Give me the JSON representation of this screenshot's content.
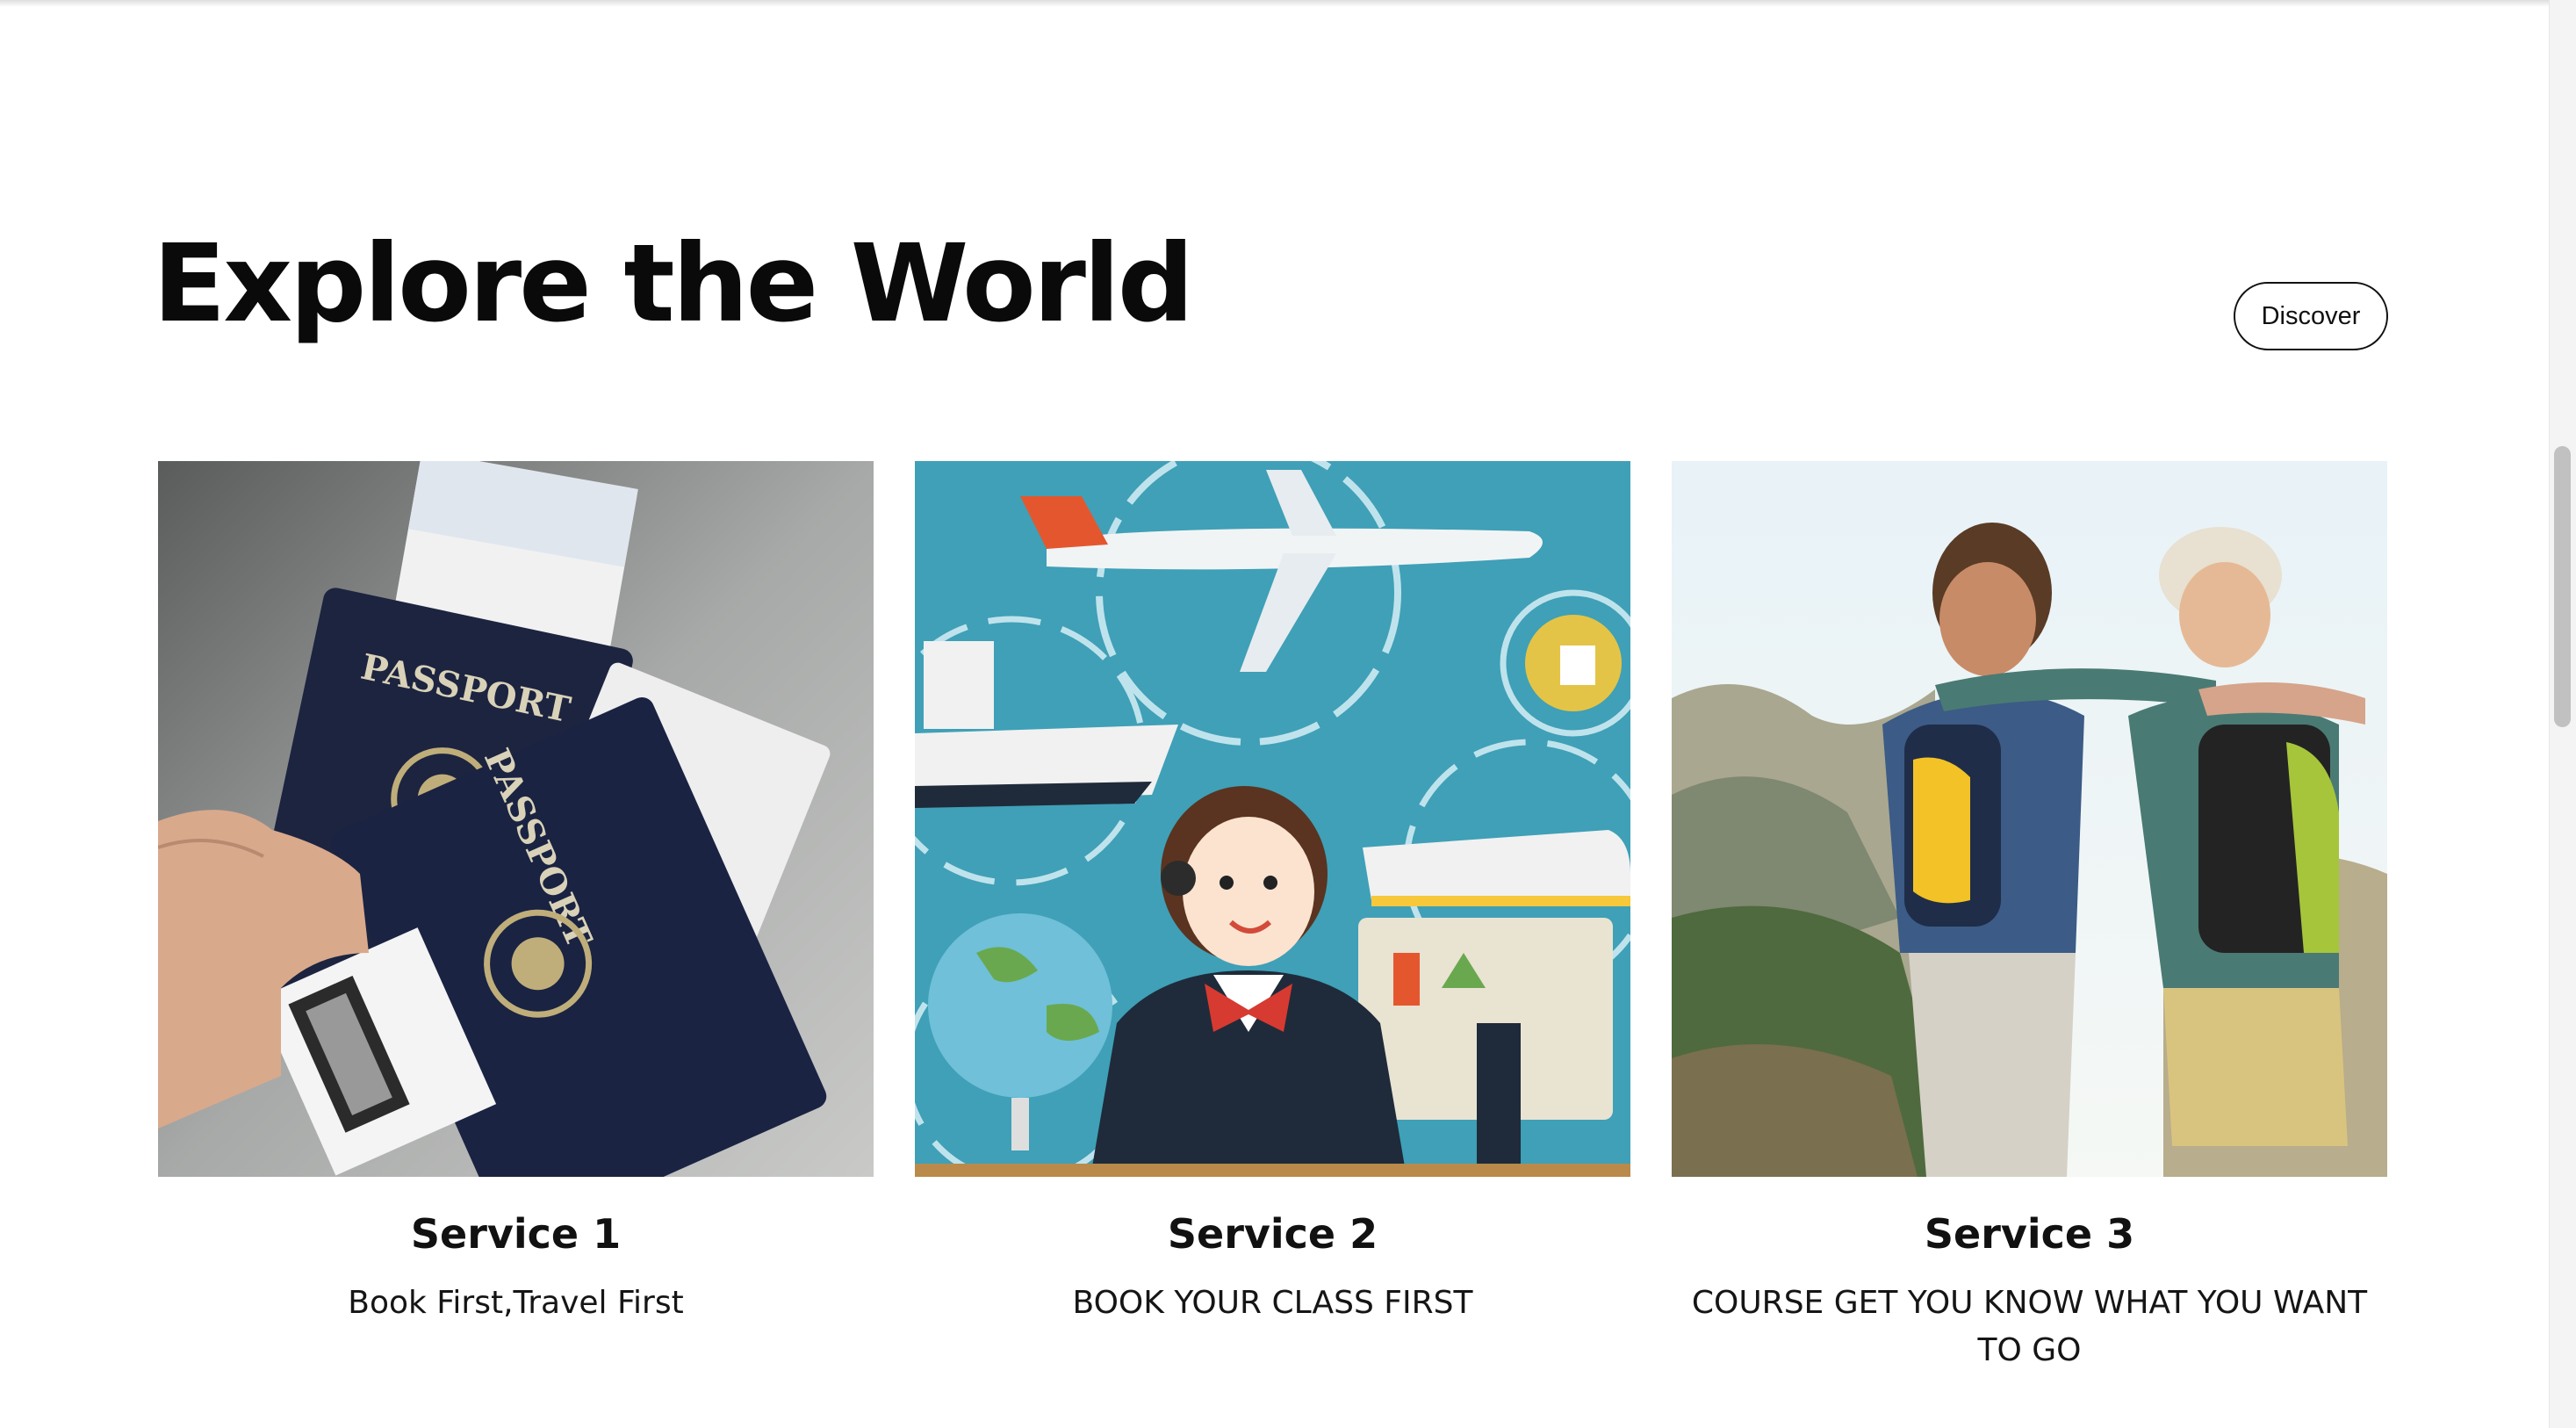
{
  "section": {
    "title": "Explore the World",
    "discover_label": "Discover"
  },
  "services": [
    {
      "title": "Service 1",
      "description": "Book First,Travel First",
      "image_icon": "passport-image"
    },
    {
      "title": "Service 2",
      "description": "BOOK YOUR CLASS FIRST",
      "image_icon": "travel-agent-illustration"
    },
    {
      "title": "Service 3",
      "description": "COURSE GET YOU KNOW WHAT YOU WANT TO GO",
      "image_icon": "hikers-image"
    }
  ],
  "images": {
    "passport_cover_text": "PASSPORT"
  },
  "colors": {
    "text": "#111111",
    "passport_navy": "#1c2440",
    "illustration_teal": "#3fa0b7",
    "scrollbar_thumb": "#c1c1c1"
  }
}
